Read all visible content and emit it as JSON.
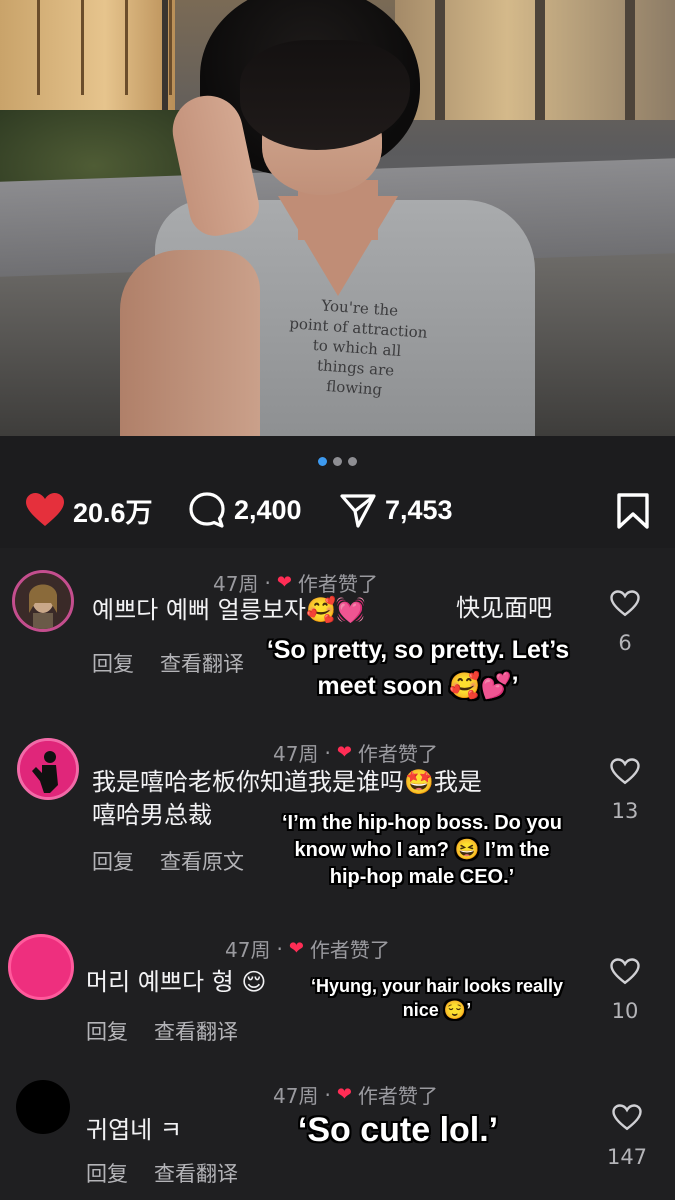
{
  "post": {
    "shirt_text": [
      "You're the",
      "point of attraction",
      "to which all",
      "things are",
      "flowing"
    ],
    "carousel_active_index": 0,
    "carousel_count": 3
  },
  "actions": {
    "likes": "20.6万",
    "comments": "2,400",
    "shares": "7,453"
  },
  "colors": {
    "like_red": "#e5303c",
    "accent_blue": "#3d9af0",
    "background": "#1f1f21"
  },
  "comments": [
    {
      "time": "47周",
      "author_liked": "作者赞了",
      "text_lines": [
        "예쁘다 예뻐 얼릉보자🥰💓"
      ],
      "extra_text": "快见面吧",
      "reply": "回复",
      "translate": "查看翻译",
      "like_count": "6",
      "overlay_lines": [
        "‘So pretty, so pretty. Let’s",
        "meet soon 🥰💕’"
      ]
    },
    {
      "time": "47周",
      "author_liked": "作者赞了",
      "text_lines": [
        "我是嘻哈老板你知道我是谁吗🤩我是",
        "嘻哈男总裁"
      ],
      "reply": "回复",
      "translate": "查看原文",
      "like_count": "13",
      "overlay_lines": [
        "‘I’m the hip-hop boss. Do you",
        "know who I am? 😆 I’m the",
        "hip-hop male CEO.’"
      ]
    },
    {
      "time": "47周",
      "author_liked": "作者赞了",
      "text_lines": [
        "머리 예쁘다 형 😌"
      ],
      "reply": "回复",
      "translate": "查看翻译",
      "like_count": "10",
      "overlay_lines": [
        "‘Hyung, your hair looks really",
        "nice 😌’"
      ]
    },
    {
      "time": "47周",
      "author_liked": "作者赞了",
      "text_lines": [
        "귀엽네 ㅋ"
      ],
      "reply": "回复",
      "translate": "查看翻译",
      "like_count": "147",
      "overlay_lines": [
        "‘So cute lol.’"
      ]
    }
  ]
}
